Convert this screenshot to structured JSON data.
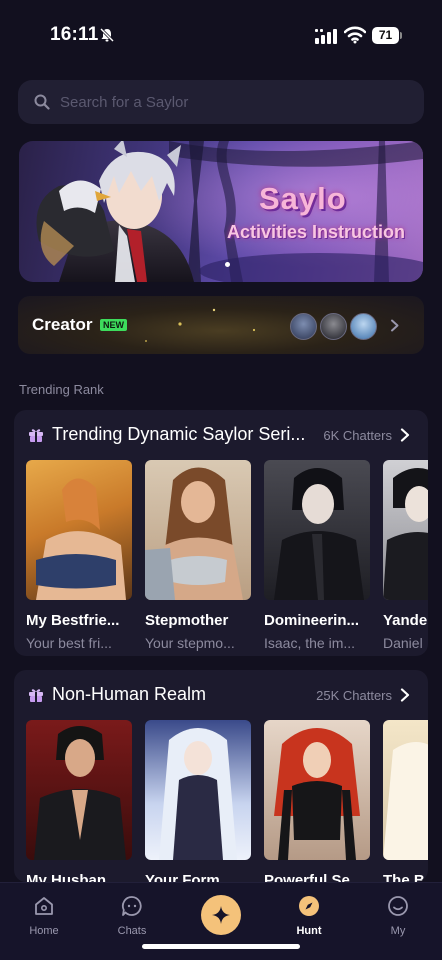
{
  "status_bar": {
    "time": "16:11",
    "battery": "71"
  },
  "search": {
    "placeholder": "Search for a Saylor"
  },
  "banner": {
    "title": "Saylo",
    "subtitle": "Activities Instruction"
  },
  "creator": {
    "label": "Creator",
    "badge": "NEW"
  },
  "section_label": "Trending Rank",
  "rankings": [
    {
      "title": "Trending Dynamic Saylor Seri...",
      "count": "6K Chatters",
      "items": [
        {
          "name": "My Bestfrie...",
          "desc": "Your best fri..."
        },
        {
          "name": "Stepmother",
          "desc": "Your stepmo..."
        },
        {
          "name": "Domineerin...",
          "desc": "Isaac, the im..."
        },
        {
          "name": "Yande",
          "desc": "Daniel"
        }
      ]
    },
    {
      "title": "Non-Human Realm",
      "count": "25K Chatters",
      "items": [
        {
          "name": "My Husban...",
          "desc": ""
        },
        {
          "name": "Your Form...",
          "desc": ""
        },
        {
          "name": "Powerful Se...",
          "desc": ""
        },
        {
          "name": "The Bu",
          "desc": ""
        }
      ]
    }
  ],
  "nav": [
    {
      "label": "Home",
      "icon": "home-icon"
    },
    {
      "label": "Chats",
      "icon": "chat-icon"
    },
    {
      "label": "",
      "icon": "sparkle-icon"
    },
    {
      "label": "Hunt",
      "icon": "compass-icon"
    },
    {
      "label": "My",
      "icon": "smile-icon"
    }
  ],
  "colors": {
    "accent": "#f4c27a",
    "background": "#12101f",
    "card": "#1c1a2d",
    "badge": "#3ddc5c"
  }
}
